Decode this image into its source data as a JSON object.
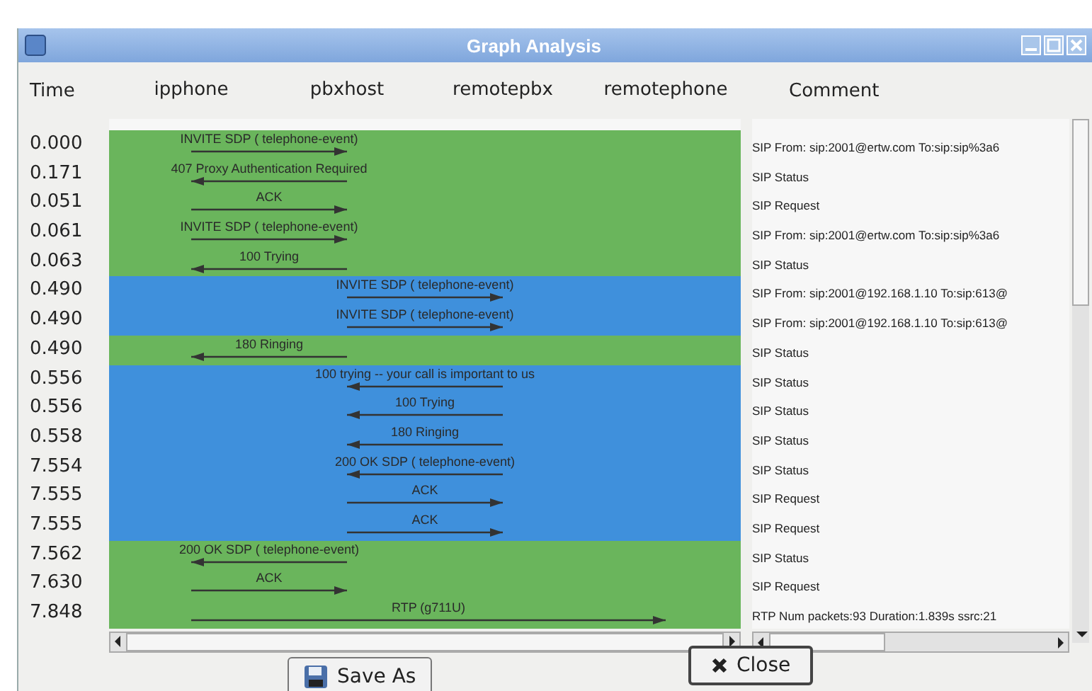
{
  "window": {
    "title": "Graph Analysis"
  },
  "columns": {
    "time": "Time",
    "nodes": [
      "ipphone",
      "pbxhost",
      "remotepbx",
      "remotephone"
    ],
    "comment": "Comment"
  },
  "rows": [
    {
      "time": "0.000",
      "label": "INVITE SDP ( telephone-event)",
      "kind": "ab",
      "color": "#6ab55c",
      "comment": "SIP From: sip:2001@ertw.com To:sip:sip%3a6"
    },
    {
      "time": "0.171",
      "label": "407 Proxy Authentication Required",
      "kind": "ba",
      "color": "#6ab55c",
      "comment": "SIP Status"
    },
    {
      "time": "0.051",
      "label": "ACK",
      "kind": "ab",
      "color": "#6ab55c",
      "comment": "SIP Request"
    },
    {
      "time": "0.061",
      "label": "INVITE SDP ( telephone-event)",
      "kind": "ab",
      "color": "#6ab55c",
      "comment": "SIP From: sip:2001@ertw.com To:sip:sip%3a6"
    },
    {
      "time": "0.063",
      "label": "100 Trying",
      "kind": "ba",
      "color": "#6ab55c",
      "comment": "SIP Status"
    },
    {
      "time": "0.490",
      "label": "INVITE SDP ( telephone-event)",
      "kind": "bc",
      "color": "#3f90dc",
      "comment": "SIP From: sip:2001@192.168.1.10 To:sip:613@"
    },
    {
      "time": "0.490",
      "label": "INVITE SDP ( telephone-event)",
      "kind": "bc",
      "color": "#3f90dc",
      "comment": "SIP From: sip:2001@192.168.1.10 To:sip:613@"
    },
    {
      "time": "0.490",
      "label": "180 Ringing",
      "kind": "ba",
      "color": "#6ab55c",
      "comment": "SIP Status"
    },
    {
      "time": "0.556",
      "label": "100 trying -- your call is important to us",
      "kind": "cb",
      "color": "#3f90dc",
      "comment": "SIP Status"
    },
    {
      "time": "0.556",
      "label": "100 Trying",
      "kind": "cb",
      "color": "#3f90dc",
      "comment": "SIP Status"
    },
    {
      "time": "0.558",
      "label": "180 Ringing",
      "kind": "cb",
      "color": "#3f90dc",
      "comment": "SIP Status"
    },
    {
      "time": "7.554",
      "label": "200 OK SDP ( telephone-event)",
      "kind": "cb",
      "color": "#3f90dc",
      "comment": "SIP Status"
    },
    {
      "time": "7.555",
      "label": "ACK",
      "kind": "bc",
      "color": "#3f90dc",
      "comment": "SIP Request"
    },
    {
      "time": "7.555",
      "label": "ACK",
      "kind": "bc",
      "color": "#3f90dc",
      "comment": "SIP Request"
    },
    {
      "time": "7.562",
      "label": "200 OK SDP ( telephone-event)",
      "kind": "ba",
      "color": "#6ab55c",
      "comment": "SIP Status"
    },
    {
      "time": "7.630",
      "label": "ACK",
      "kind": "ab",
      "color": "#6ab55c",
      "comment": "SIP Request"
    },
    {
      "time": "7.848",
      "label": "RTP (g711U)",
      "kind": "ad",
      "color": "#6ab55c",
      "comment": "RTP Num packets:93  Duration:1.839s ssrc:21"
    }
  ],
  "buttons": {
    "save": "Save As",
    "close": "Close"
  }
}
